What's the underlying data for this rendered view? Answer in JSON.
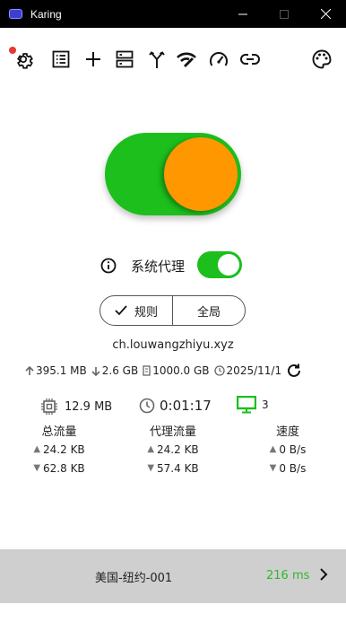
{
  "window": {
    "title": "Karing"
  },
  "proxy": {
    "label": "系统代理",
    "enabled": true
  },
  "mode": {
    "rule_label": "规则",
    "global_label": "全局",
    "selected": "rule"
  },
  "host": "ch.louwangzhiyu.xyz",
  "subscription": {
    "upload": "395.1 MB",
    "download": "2.6 GB",
    "total": "1000.0 GB",
    "expire": "2025/11/1"
  },
  "metrics": {
    "memory": "12.9 MB",
    "uptime": "0:01:17",
    "connections": "3"
  },
  "traffic": {
    "total": {
      "title": "总流量",
      "up": "24.2 KB",
      "down": "62.8 KB"
    },
    "proxy": {
      "title": "代理流量",
      "up": "24.2 KB",
      "down": "57.4 KB"
    },
    "speed": {
      "title": "速度",
      "up": "0 B/s",
      "down": "0 B/s"
    }
  },
  "server": {
    "name": "美国-纽约-001",
    "latency": "216 ms"
  },
  "colors": {
    "accent": "#1cbf1c",
    "knob": "#ff9800",
    "bottom_bar": "#cfcfcf"
  }
}
